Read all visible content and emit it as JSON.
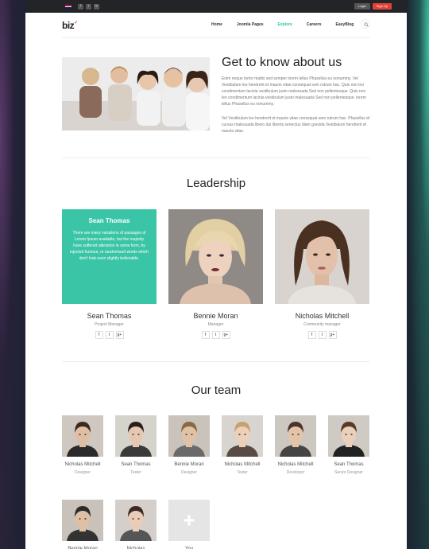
{
  "topbar": {
    "social": [
      "f",
      "t",
      "in"
    ],
    "login_label": "Login",
    "signup_label": "Sign Up"
  },
  "header": {
    "logo": "biz",
    "nav": [
      "Home",
      "Joomla Pages",
      "Explore",
      "Careers",
      "EasyBlog"
    ],
    "active_nav": "Explore"
  },
  "about": {
    "title": "Get to know about us",
    "paragraph1": "Enim neque tortor mattis sed semper lorem tellus Phasellus eu nonummy. Vel Vestibulum leo hendrerit et mauris vitae consequat sem rutrum hac. Quis non leo condimentum lacinia vestibulum justo malesuada Sed non pellentesque. Quis non leo condimentum lacinia vestibulum justo malesuada Sed non pellentesque. lorem tellus Phasellus eu nonummy.",
    "paragraph2": "Vel Vestibulum leo hendrerit et mauris vitae consequat sem rutrum hac. Phasellus id cursus malesuada libero dui libortis senectus diam gravida Vestibulum hendrerit et mauris vitae."
  },
  "leadership": {
    "title": "Leadership",
    "members": [
      {
        "name": "Sean Thomas",
        "role": "Project Manager",
        "overlay_name": "Sean Thomas",
        "overlay_text": "There are many variations of passages of Lorem Ipsum available, but the majority have suffered alteration in some form, by injected humour, or randomised words which don't look even slightly believable."
      },
      {
        "name": "Bennie Moran",
        "role": "Manager"
      },
      {
        "name": "Nicholas Mitchell",
        "role": "Community manager"
      }
    ],
    "social": [
      "f",
      "t",
      "g+"
    ]
  },
  "team": {
    "title": "Our team",
    "members": [
      {
        "name": "Nicholas Mitchell",
        "role": "Designer"
      },
      {
        "name": "Sean Thomas",
        "role": "Tester"
      },
      {
        "name": "Bennie Moran",
        "role": "Designer"
      },
      {
        "name": "Nicholas Mitchell",
        "role": "Tester"
      },
      {
        "name": "Nicholas Mitchell",
        "role": "Developer"
      },
      {
        "name": "Sean Thomas",
        "role": "Senior Designer"
      },
      {
        "name": "Bennie Moran",
        "role": ""
      },
      {
        "name": "Nicholas",
        "role": ""
      },
      {
        "name": "You",
        "role": ""
      }
    ]
  },
  "colors": {
    "accent": "#2fc4a5",
    "signup": "#e0423a",
    "topbar": "#222427"
  }
}
